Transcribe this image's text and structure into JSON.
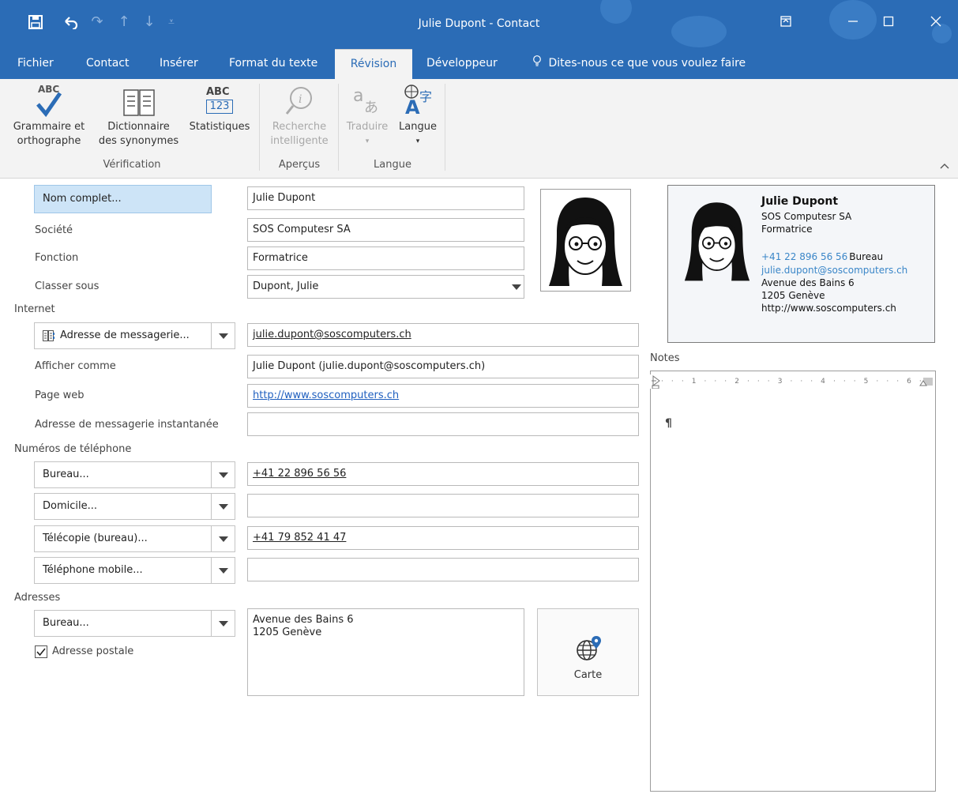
{
  "window": {
    "title": "Julie Dupont  -  Contact"
  },
  "tabs": [
    {
      "label": "Fichier"
    },
    {
      "label": "Contact"
    },
    {
      "label": "Insérer"
    },
    {
      "label": "Format du texte"
    },
    {
      "label": "Révision",
      "active": true
    },
    {
      "label": "Développeur"
    }
  ],
  "tell_me": "Dites-nous ce que vous voulez faire",
  "ribbon": {
    "grammar_line1": "Grammaire et",
    "grammar_line2": "orthographe",
    "thesaurus_line1": "Dictionnaire",
    "thesaurus_line2": "des synonymes",
    "stats": "Statistiques",
    "smart_line1": "Recherche",
    "smart_line2": "intelligente",
    "translate": "Traduire",
    "language": "Langue",
    "group_verification": "Vérification",
    "group_insights": "Aperçus",
    "group_language": "Langue",
    "abc": "ABC",
    "num": "123"
  },
  "form": {
    "full_name_button": "Nom complet...",
    "full_name": "Julie Dupont",
    "company_label": "Société",
    "company": "SOS Computesr SA",
    "job_label": "Fonction",
    "job": "Formatrice",
    "file_as_label": "Classer sous",
    "file_as": "Dupont, Julie",
    "internet_section": "Internet",
    "email_dropdown": "Adresse de messagerie...",
    "email": "julie.dupont@soscomputers.ch",
    "display_as_label": "Afficher comme",
    "display_as": "Julie Dupont (julie.dupont@soscomputers.ch)",
    "web_label": "Page web",
    "web": "http://www.soscomputers.ch",
    "im_label": "Adresse de messagerie instantanée",
    "im": "",
    "phones_section": "Numéros de téléphone",
    "phones": [
      {
        "type": "Bureau...",
        "value": "+41 22 896 56 56"
      },
      {
        "type": "Domicile...",
        "value": ""
      },
      {
        "type": "Télécopie (bureau)...",
        "value": "+41 79 852 41 47"
      },
      {
        "type": "Téléphone mobile...",
        "value": ""
      }
    ],
    "addresses_section": "Adresses",
    "address_type": "Bureau...",
    "address_line1": "Avenue des Bains 6",
    "address_line2": "1205 Genève",
    "postal_checkbox": "Adresse postale",
    "postal_checked": true,
    "map_button": "Carte"
  },
  "card": {
    "name": "Julie Dupont",
    "company": "SOS Computesr SA",
    "job": "Formatrice",
    "phone": "+41 22 896 56 56",
    "phone_type": "Bureau",
    "email": "julie.dupont@soscomputers.ch",
    "street": "Avenue des Bains 6",
    "city": "1205 Genève",
    "web": "http://www.soscomputers.ch"
  },
  "notes": {
    "label": "Notes",
    "paragraph_mark": "¶",
    "ruler_numbers": [
      "1",
      "2",
      "3",
      "4",
      "5",
      "6"
    ]
  },
  "colors": {
    "titlebar": "#2b6cb6",
    "accent": "#2b6cb6",
    "link": "#1f5fbf"
  }
}
